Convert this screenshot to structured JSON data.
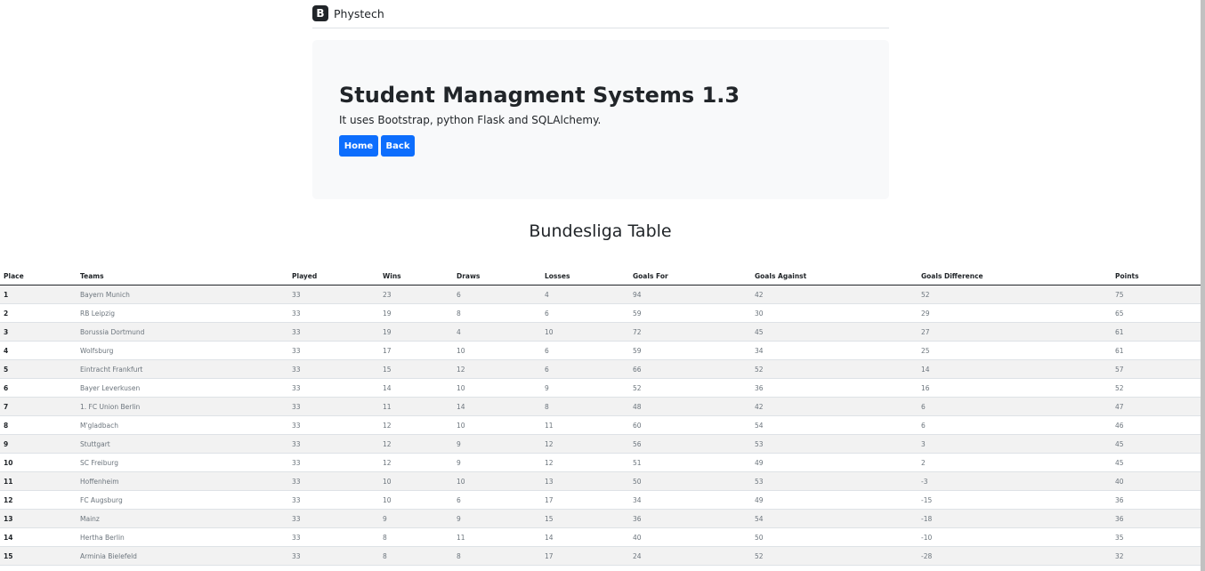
{
  "navbar": {
    "brand_icon_letter": "B",
    "brand": "Phystech"
  },
  "jumbotron": {
    "title": "Student Managment Systems 1.3",
    "description": "It uses Bootstrap, python Flask and SQLAlchemy.",
    "home_button": "Home",
    "back_button": "Back"
  },
  "table": {
    "title": "Bundesliga Table",
    "headers": [
      "Place",
      "Teams",
      "Played",
      "Wins",
      "Draws",
      "Losses",
      "Goals For",
      "Goals Against",
      "Goals Difference",
      "Points"
    ],
    "rows": [
      [
        "1",
        "Bayern Munich",
        "33",
        "23",
        "6",
        "4",
        "94",
        "42",
        "52",
        "75"
      ],
      [
        "2",
        "RB Leipzig",
        "33",
        "19",
        "8",
        "6",
        "59",
        "30",
        "29",
        "65"
      ],
      [
        "3",
        "Borussia Dortmund",
        "33",
        "19",
        "4",
        "10",
        "72",
        "45",
        "27",
        "61"
      ],
      [
        "4",
        "Wolfsburg",
        "33",
        "17",
        "10",
        "6",
        "59",
        "34",
        "25",
        "61"
      ],
      [
        "5",
        "Eintracht Frankfurt",
        "33",
        "15",
        "12",
        "6",
        "66",
        "52",
        "14",
        "57"
      ],
      [
        "6",
        "Bayer Leverkusen",
        "33",
        "14",
        "10",
        "9",
        "52",
        "36",
        "16",
        "52"
      ],
      [
        "7",
        "1. FC Union Berlin",
        "33",
        "11",
        "14",
        "8",
        "48",
        "42",
        "6",
        "47"
      ],
      [
        "8",
        "M'gladbach",
        "33",
        "12",
        "10",
        "11",
        "60",
        "54",
        "6",
        "46"
      ],
      [
        "9",
        "Stuttgart",
        "33",
        "12",
        "9",
        "12",
        "56",
        "53",
        "3",
        "45"
      ],
      [
        "10",
        "SC Freiburg",
        "33",
        "12",
        "9",
        "12",
        "51",
        "49",
        "2",
        "45"
      ],
      [
        "11",
        "Hoffenheim",
        "33",
        "10",
        "10",
        "13",
        "50",
        "53",
        "-3",
        "40"
      ],
      [
        "12",
        "FC Augsburg",
        "33",
        "10",
        "6",
        "17",
        "34",
        "49",
        "-15",
        "36"
      ],
      [
        "13",
        "Mainz",
        "33",
        "9",
        "9",
        "15",
        "36",
        "54",
        "-18",
        "36"
      ],
      [
        "14",
        "Hertha Berlin",
        "33",
        "8",
        "11",
        "14",
        "40",
        "50",
        "-10",
        "35"
      ],
      [
        "15",
        "Arminia Bielefeld",
        "33",
        "8",
        "8",
        "17",
        "24",
        "52",
        "-28",
        "32"
      ]
    ]
  },
  "colors": {
    "primary": "#0d6efd",
    "jumbotron_bg": "#f8f9fa",
    "striped_row": "#f2f2f2",
    "text": "#212529"
  }
}
